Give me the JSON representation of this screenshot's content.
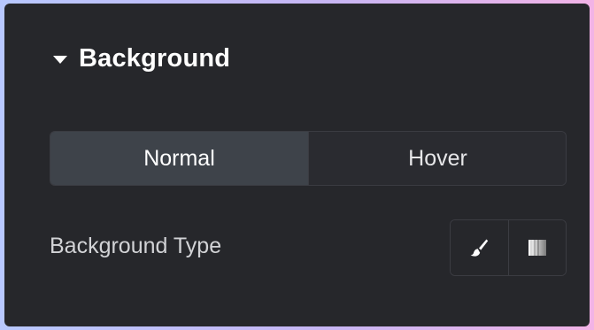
{
  "section": {
    "title": "Background",
    "caret_icon": "caret-down-icon"
  },
  "tabs": [
    {
      "label": "Normal",
      "active": true
    },
    {
      "label": "Hover",
      "active": false
    }
  ],
  "background_type": {
    "label": "Background Type",
    "options": [
      {
        "icon": "brush-icon",
        "meaning": "classic"
      },
      {
        "icon": "gradient-icon",
        "meaning": "gradient"
      }
    ]
  },
  "colors": {
    "panel": "#26272b",
    "active_tab": "#3e434a",
    "border": "#3b3c42"
  }
}
